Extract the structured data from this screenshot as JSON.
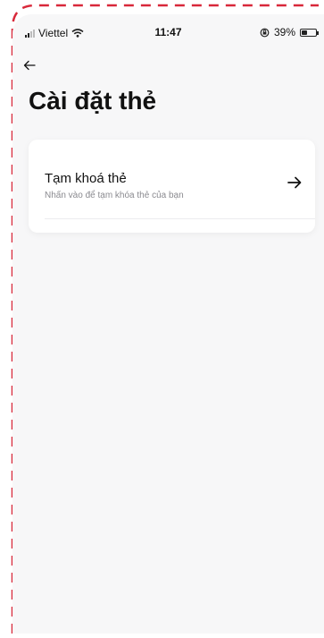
{
  "status_bar": {
    "carrier": "Viettel",
    "time": "11:47",
    "battery": "39%",
    "battery_level": 0.39
  },
  "page": {
    "title": "Cài đặt thẻ"
  },
  "settings": {
    "items": [
      {
        "title": "Tạm khoá thẻ",
        "subtitle": "Nhấn vào để tạm khóa thẻ của bạn"
      }
    ]
  },
  "colors": {
    "dashed_border": "#d8283a",
    "background": "#f7f7f8",
    "card": "#ffffff"
  },
  "icons": {
    "back": "arrow-left-icon",
    "item_arrow": "arrow-right-icon",
    "wifi": "wifi-icon",
    "signal": "signal-icon",
    "orientation_lock": "orientation-lock-icon",
    "battery": "battery-icon"
  }
}
